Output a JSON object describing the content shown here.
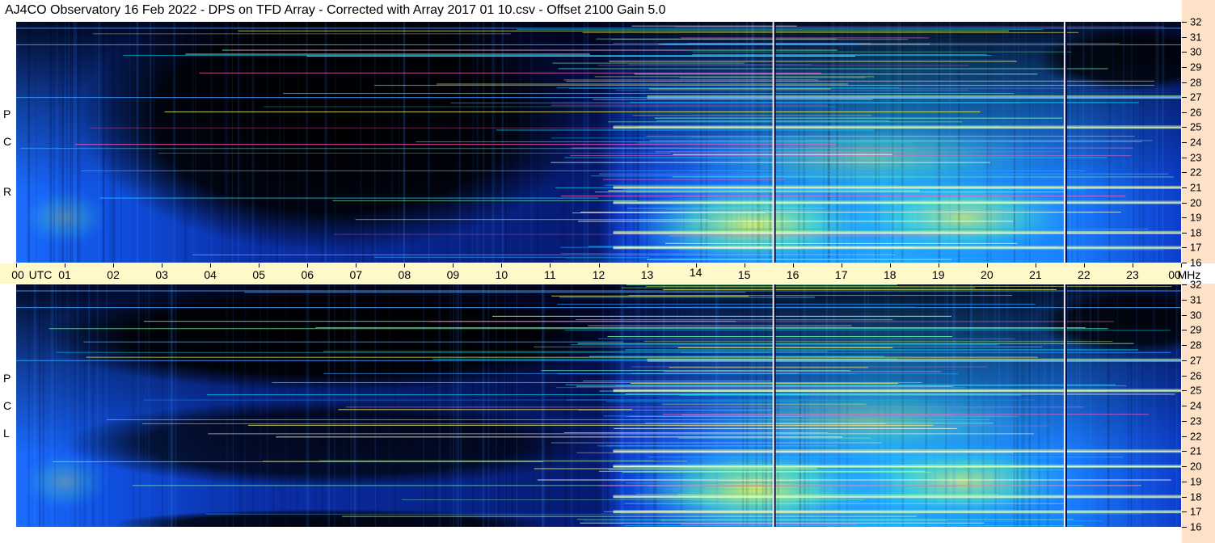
{
  "title": "AJ4CO Observatory  16 Feb 2022  -  DPS on TFD Array  -  Corrected with Array 2017 01 10.csv  -  Offset 2100  Gain 5.0",
  "panels": [
    {
      "id": "rcp",
      "letters": [
        "R",
        "C",
        "P"
      ]
    },
    {
      "id": "lcp",
      "letters": [
        "L",
        "C",
        "P"
      ]
    }
  ],
  "time_axis": {
    "labels": [
      "00",
      "UTC",
      "01",
      "02",
      "03",
      "04",
      "05",
      "06",
      "07",
      "08",
      "09",
      "10",
      "11",
      "12",
      "13",
      "14",
      "15",
      "16",
      "17",
      "18",
      "19",
      "20",
      "21",
      "22",
      "23",
      "00",
      "MHz"
    ]
  },
  "colors": {
    "spectrum_low": "#000000",
    "spectrum_mid": "#1450ff",
    "spectrum_high": "#00c8ff",
    "spectrum_peak": "#f0ff40",
    "time_axis_bg": "#fff8c8",
    "freq_axis_bg": "#fde2c8"
  },
  "chart_data": {
    "type": "heatmap",
    "title": "AJ4CO Observatory  16 Feb 2022  -  DPS on TFD Array  -  Corrected with Array 2017 01 10.csv  -  Offset 2100  Gain 5.0",
    "xlabel": "UTC",
    "ylabel": "MHz",
    "x_range": [
      0,
      24
    ],
    "y_range": [
      16,
      32
    ],
    "x_ticks": [
      "00",
      "01",
      "02",
      "03",
      "04",
      "05",
      "06",
      "07",
      "08",
      "09",
      "10",
      "11",
      "12",
      "13",
      "14",
      "15",
      "16",
      "17",
      "18",
      "19",
      "20",
      "21",
      "22",
      "23",
      "00"
    ],
    "y_ticks": [
      "16",
      "17",
      "18",
      "19",
      "20",
      "21",
      "22",
      "23",
      "24",
      "25",
      "26",
      "27",
      "28",
      "29",
      "30",
      "31",
      "32"
    ],
    "panels": [
      "RCP",
      "LCP"
    ],
    "description_values": {
      "bright_period_utc": [
        12.5,
        24
      ],
      "dark_period_utc": [
        2,
        12
      ],
      "vertical_marker_utc": [
        15.6,
        21.6
      ],
      "strong_interference_mhz": [
        27,
        25,
        21,
        20,
        18,
        17
      ]
    }
  }
}
